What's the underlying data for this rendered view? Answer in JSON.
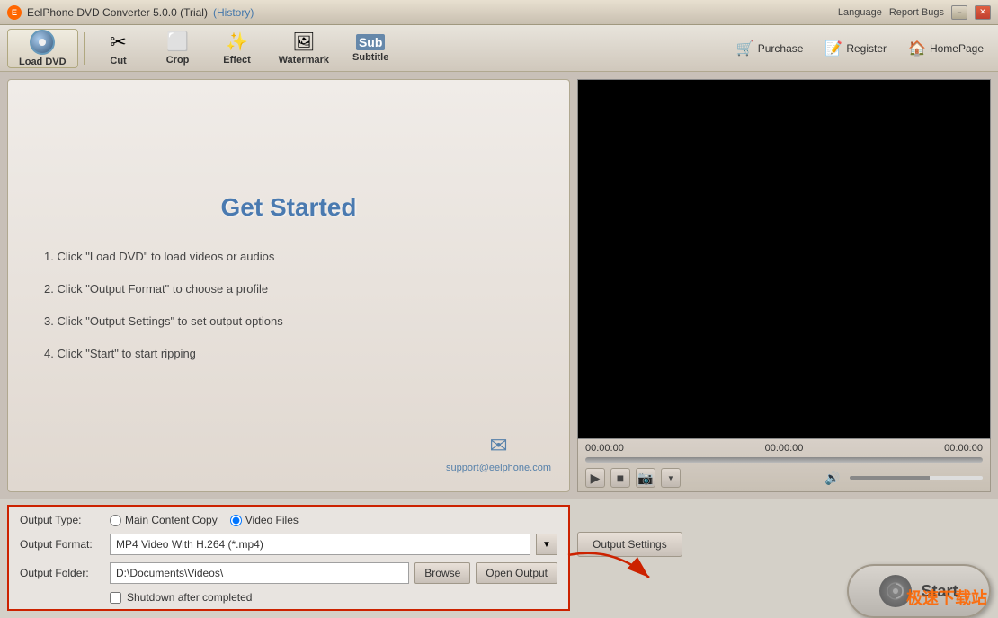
{
  "titlebar": {
    "app_name": "EelPhone DVD Converter 5.0.0 (Trial)",
    "history": "(History)",
    "language": "Language",
    "report_bugs": "Report Bugs",
    "minimize_label": "−",
    "close_label": "✕"
  },
  "toolbar": {
    "load_dvd": "Load DVD",
    "cut": "Cut",
    "crop": "Crop",
    "effect": "Effect",
    "watermark": "Watermark",
    "subtitle": "Subtitle",
    "purchase": "Purchase",
    "register": "Register",
    "homepage": "HomePage"
  },
  "get_started": {
    "title": "Get Started",
    "step1": "1. Click \"Load DVD\" to load videos or audios",
    "step2": "2. Click \"Output Format\" to choose  a profile",
    "step3": "3. Click \"Output Settings\" to set output options",
    "step4": "4. Click \"Start\" to start ripping",
    "support_email": "support@eelphone.com"
  },
  "video": {
    "time_start": "00:00:00",
    "time_mid": "00:00:00",
    "time_end": "00:00:00"
  },
  "settings": {
    "output_type_label": "Output Type:",
    "output_format_label": "Output Format:",
    "output_folder_label": "Output Folder:",
    "radio_main_copy": "Main Content Copy",
    "radio_video_files": "Video Files",
    "format_value": "MP4 Video With H.264 (*.mp4)",
    "folder_value": "D:\\Documents\\Videos\\",
    "browse_label": "Browse",
    "open_output_label": "Open Output",
    "shutdown_label": "Shutdown after completed",
    "output_settings_btn": "Output Settings",
    "start_label": "Start"
  },
  "watermark": {
    "text": "极速下载站"
  }
}
